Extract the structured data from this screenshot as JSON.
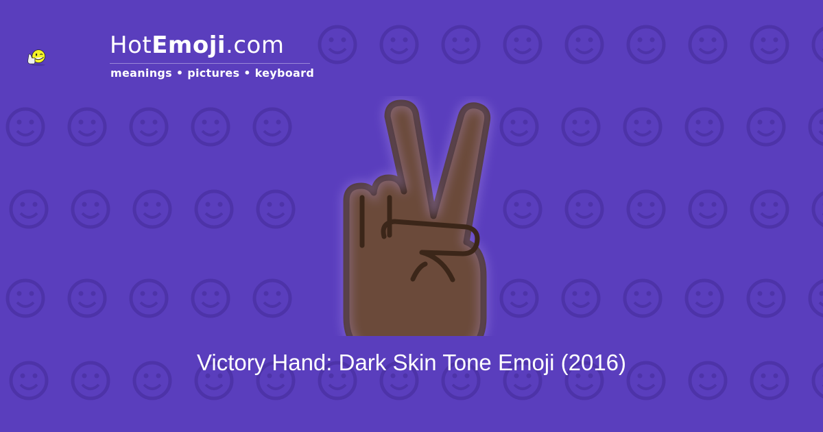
{
  "logo": {
    "prefix": "Hot",
    "bold": "Emoji",
    "suffix": ".com",
    "tagline": "meanings • pictures • keyboard"
  },
  "emoji": {
    "title": "Victory Hand: Dark Skin Tone Emoji (2016)",
    "skin_color": "#6b4a3a",
    "outline_color": "#3b2619"
  },
  "colors": {
    "background": "#5a3ebd",
    "pattern": "#4d33a8"
  }
}
